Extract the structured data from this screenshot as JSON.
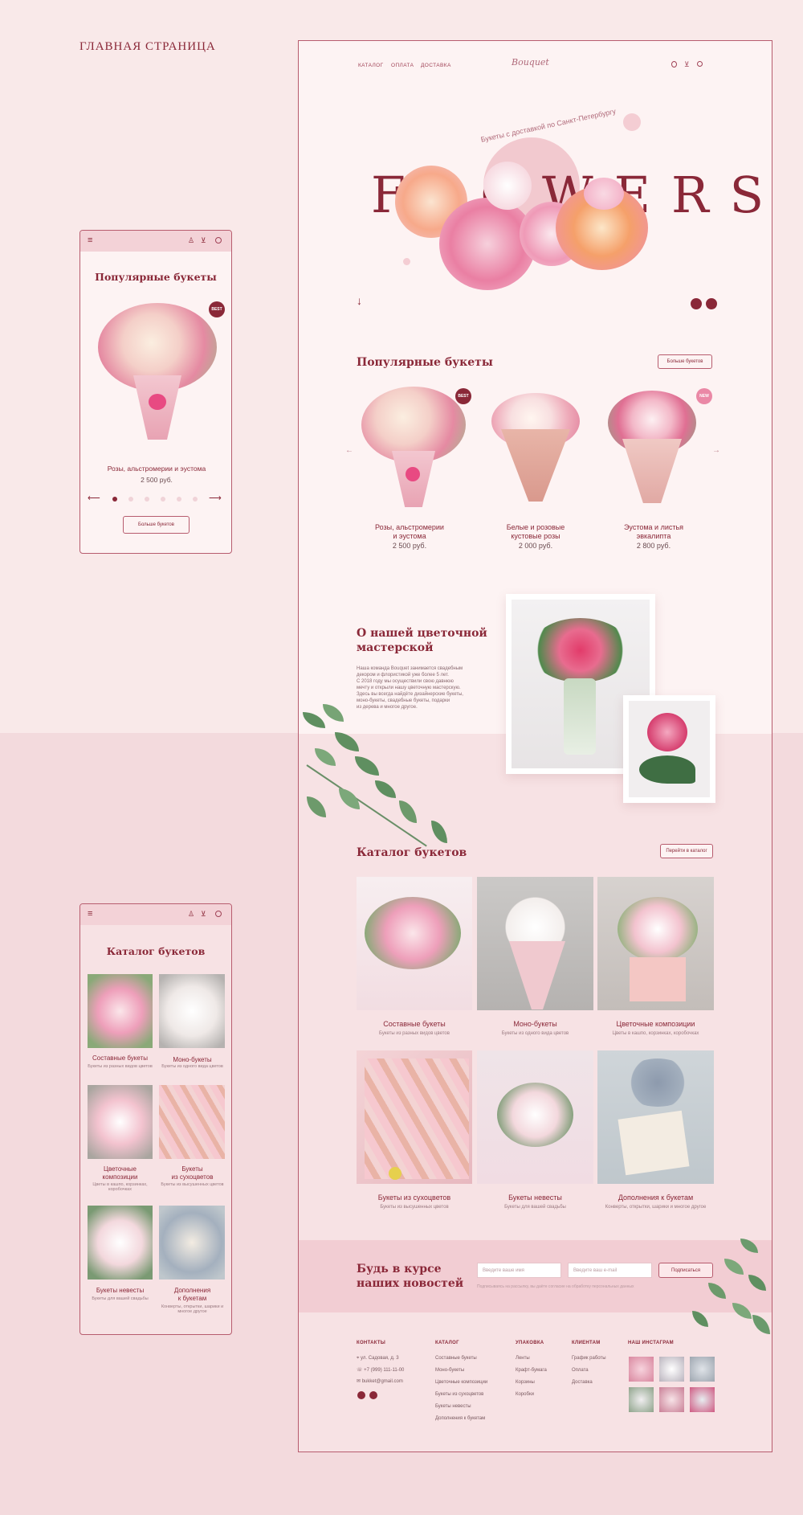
{
  "page_label": "ГЛАВНАЯ СТРАНИЦА",
  "colors": {
    "accent": "#8a2838",
    "pink_bg": "#f9e9e9",
    "frame_border": "#b75c6e"
  },
  "nav": {
    "items": [
      "КАТАЛОГ",
      "ОПЛАТА",
      "ДОСТАВКА"
    ],
    "logo": "Bouquet",
    "icons": [
      "user-icon",
      "cart-icon",
      "search-icon"
    ]
  },
  "hero": {
    "tagline": "Букеты с доставкой по Санкт-Петербургу",
    "word": "FLOWERS"
  },
  "popular": {
    "title": "Популярные букеты",
    "more_button": "Больше букетов",
    "products": [
      {
        "name_line1": "Розы, альстромерии",
        "name_line2": "и эустома",
        "price": "2 500 руб.",
        "badge": "BEST"
      },
      {
        "name_line1": "Белые и розовые",
        "name_line2": "кустовые розы",
        "price": "2 000 руб.",
        "badge": ""
      },
      {
        "name_line1": "Эустома и листья",
        "name_line2": "эвкалипта",
        "price": "2 800 руб.",
        "badge": "NEW"
      }
    ]
  },
  "about": {
    "title_line1": "О нашей цветочной",
    "title_line2": "мастерской",
    "text": [
      "Наша команда Bouquet занимается свадебным",
      "декором и флористикой уже более 5 лет.",
      "С 2018 году мы осуществили свою давнюю",
      "мечту и открыли нашу цветочную мастерскую.",
      "Здесь вы всегда найдёте дизайнерские букеты,",
      "моно-букеты, свадебные букеты, подарки",
      "из дерева и многое другое."
    ]
  },
  "catalog": {
    "title": "Каталог букетов",
    "button": "Перейти в каталог",
    "items": [
      {
        "name": "Составные букеты",
        "sub": "Букеты из разных видов цветов"
      },
      {
        "name": "Моно-букеты",
        "sub": "Букеты из одного вида цветов"
      },
      {
        "name": "Цветочные композиции",
        "sub": "Цветы в кашпо, корзинках, коробочках"
      },
      {
        "name": "Букеты из сухоцветов",
        "sub": "Букеты из высушенных цветов"
      },
      {
        "name": "Букеты невесты",
        "sub": "Букеты для вашей свадьбы"
      },
      {
        "name": "Дополнения к букетам",
        "sub": "Конверты, открытки, шарики и многое другое"
      }
    ]
  },
  "newsletter": {
    "title_line1": "Будь в курсе",
    "title_line2": "наших новостей",
    "name_placeholder": "Введите ваше имя",
    "email_placeholder": "Введите ваш e-mail",
    "button": "Подписаться",
    "consent": "Подписываясь на рассылку, вы даёте согласие на обработку персональных данных"
  },
  "footer": {
    "contacts": {
      "title": "КОНТАКТЫ",
      "address": "ул. Садовая, д. 3",
      "phone": "+7 (999) 111-11-00",
      "email": "bukket@gmail.com"
    },
    "catalog": {
      "title": "КАТАЛОГ",
      "links": [
        "Составные букеты",
        "Моно-букеты",
        "Цветочные композиции",
        "Букеты из сухоцветов",
        "Букеты невесты",
        "Дополнения к букетам"
      ]
    },
    "packaging": {
      "title": "УПАКОВКА",
      "links": [
        "Ленты",
        "Крафт-бумага",
        "Корзины",
        "Коробки"
      ]
    },
    "clients": {
      "title": "КЛИЕНТАМ",
      "links": [
        "График работы",
        "Оплата",
        "Доставка"
      ]
    },
    "instagram": {
      "title": "НАШ ИНСТАГРАМ"
    }
  },
  "mobile_popular": {
    "title": "Популярные букеты",
    "badge": "BEST",
    "product_name": "Розы, альстромерии и эустома",
    "price": "2 500 руб.",
    "button": "Больше букетов"
  },
  "mobile_catalog": {
    "title": "Каталог букетов",
    "items": [
      {
        "name": "Составные букеты",
        "sub": "Букеты из разных видов цветов"
      },
      {
        "name": "Моно-букеты",
        "sub": "Букеты из одного вида цветов"
      },
      {
        "name_line1": "Цветочные",
        "name_line2": "композиции",
        "sub": "Цветы в кашпо, корзинках, коробочках"
      },
      {
        "name_line1": "Букеты",
        "name_line2": "из сухоцветов",
        "sub": "Букеты из высушенных цветов"
      },
      {
        "name": "Букеты невесты",
        "sub": "Букеты для вашей свадьбы"
      },
      {
        "name_line1": "Дополнения",
        "name_line2": "к букетам",
        "sub": "Конверты, открытки, шарики и многое другое"
      }
    ]
  }
}
